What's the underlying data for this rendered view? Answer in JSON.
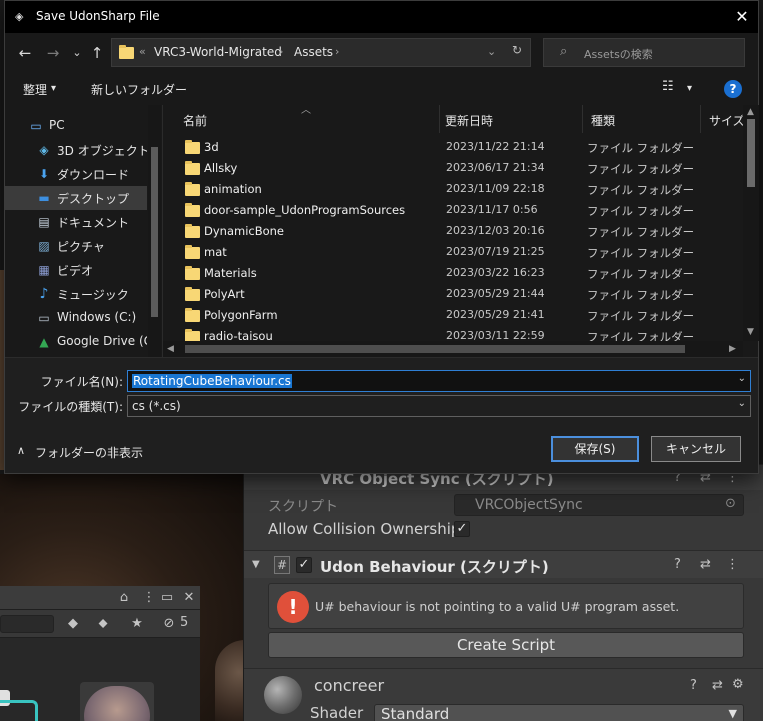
{
  "dialog": {
    "title": "Save UdonSharp File",
    "close_glyph": "✕",
    "nav": {
      "back_glyph": "←",
      "forward_glyph": "→",
      "recent_glyph": "⌄",
      "up_glyph": "↑",
      "overflow_glyph": "«",
      "breadcrumbs": [
        "VRC3-World-Migrated",
        "Assets"
      ],
      "refresh_glyph": "↻",
      "search_placeholder": "Assetsの検索",
      "search_glyph": "⌕"
    },
    "commands": {
      "organize_label": "整理",
      "organize_caret": "▾",
      "new_folder_label": "新しいフォルダー",
      "view_glyph": "☷",
      "view_caret": "▾",
      "help_glyph": "?"
    },
    "nav_tree": [
      {
        "label": "PC",
        "icon": "pc-icon",
        "glyph": "▭",
        "color": "#6fb6ff"
      },
      {
        "label": "3D オブジェクト",
        "icon": "3d-objects-icon",
        "glyph": "◈",
        "color": "#5fb9e8"
      },
      {
        "label": "ダウンロード",
        "icon": "download-icon",
        "glyph": "⬇",
        "color": "#4aa3f0"
      },
      {
        "label": "デスクトップ",
        "icon": "desktop-icon",
        "glyph": "▬",
        "color": "#3d8fe0",
        "selected": true
      },
      {
        "label": "ドキュメント",
        "icon": "documents-icon",
        "glyph": "▤",
        "color": "#c9d4e0"
      },
      {
        "label": "ピクチャ",
        "icon": "pictures-icon",
        "glyph": "▨",
        "color": "#7fb2d9"
      },
      {
        "label": "ビデオ",
        "icon": "videos-icon",
        "glyph": "▦",
        "color": "#8a9bd0"
      },
      {
        "label": "ミュージック",
        "icon": "music-icon",
        "glyph": "♪",
        "color": "#4aa3f0"
      },
      {
        "label": "Windows (C:)",
        "icon": "drive-icon",
        "glyph": "▭",
        "color": "#b9c4cf"
      },
      {
        "label": "Google Drive (G:",
        "icon": "google-drive-icon",
        "glyph": "▲",
        "color": "#34a853"
      }
    ],
    "columns": {
      "name": "名前",
      "modified": "更新日時",
      "type": "種類",
      "size": "サイズ",
      "sort_glyph": "︿"
    },
    "files": [
      {
        "name": "3d",
        "modified": "2023/11/22 21:14",
        "type": "ファイル フォルダー"
      },
      {
        "name": "Allsky",
        "modified": "2023/06/17 21:34",
        "type": "ファイル フォルダー"
      },
      {
        "name": "animation",
        "modified": "2023/11/09 22:18",
        "type": "ファイル フォルダー"
      },
      {
        "name": "door-sample_UdonProgramSources",
        "modified": "2023/11/17 0:56",
        "type": "ファイル フォルダー"
      },
      {
        "name": "DynamicBone",
        "modified": "2023/12/03 20:16",
        "type": "ファイル フォルダー"
      },
      {
        "name": "mat",
        "modified": "2023/07/19 21:25",
        "type": "ファイル フォルダー"
      },
      {
        "name": "Materials",
        "modified": "2023/03/22 16:23",
        "type": "ファイル フォルダー"
      },
      {
        "name": "PolyArt",
        "modified": "2023/05/29 21:44",
        "type": "ファイル フォルダー"
      },
      {
        "name": "PolygonFarm",
        "modified": "2023/05/29 21:41",
        "type": "ファイル フォルダー"
      },
      {
        "name": "radio-taisou",
        "modified": "2023/03/11 22:59",
        "type": "ファイル フォルダー"
      }
    ],
    "scroll_glyphs": {
      "up": "▲",
      "down": "▼",
      "left": "◀",
      "right": "▶"
    },
    "filename_label": "ファイル名(N):",
    "filename_value": "RotatingCubeBehaviour.cs",
    "filetype_label": "ファイルの種類(T):",
    "filetype_value": "cs (*.cs)",
    "dropdown_caret": "⌄",
    "hide_folders_glyph": "∧",
    "hide_folders_label": "フォルダーの非表示",
    "save_label": "保存(S)",
    "cancel_label": "キャンセル",
    "accent_color": "#1976d2"
  },
  "inspector": {
    "object_sync_title": "VRC Object Sync (スクリプト)",
    "script_label": "スクリプト",
    "script_value": "VRCObjectSync",
    "allow_collision_label": "Allow Collision Ownership",
    "udon_title": "Udon Behaviour (スクリプト)",
    "error_message": "U# behaviour is not pointing to a valid U# program asset.",
    "create_script_label": "Create Script",
    "material_name": "concreer",
    "shader_label": "Shader",
    "shader_value": "Standard",
    "icons": {
      "help": "?",
      "preset": "⇄",
      "menu": "⋮",
      "gear": "⚙",
      "check": "✓",
      "error": "!",
      "hash": "#",
      "foldout": "▼",
      "target": "⊙"
    }
  },
  "scene_toolbar": {
    "lock_glyph": "⌂",
    "max_glyph": "▭",
    "menu_glyph": "⋮",
    "count": "5",
    "tool_glyphs": [
      "◆",
      "⬥",
      "★",
      "⊘"
    ]
  }
}
